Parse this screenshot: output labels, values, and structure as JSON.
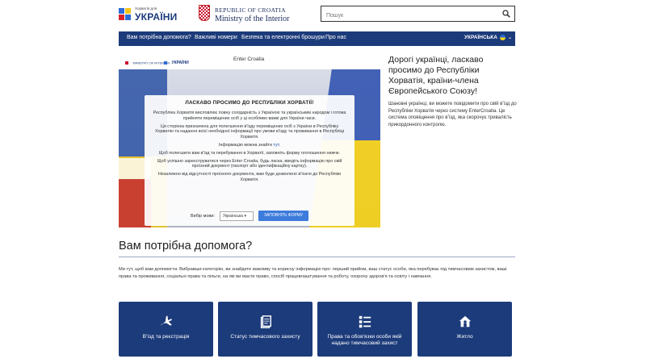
{
  "header": {
    "ua_logo_small": "Хорватія для",
    "ua_logo_big": "УКРАЇНИ",
    "mi_line1": "REPUBLIC OF CROATIA",
    "mi_line2": "Ministry of the Interior",
    "search_placeholder": "Пошук"
  },
  "nav": {
    "items": [
      {
        "label": "Вам потрібна допомога?"
      },
      {
        "label": "Важливі номери"
      },
      {
        "label": "Безпека та електронні брошури"
      },
      {
        "label": "Про нас"
      }
    ],
    "language": "УКРАЇНСЬКА"
  },
  "hero": {
    "mini_logo1": "MINISTRY OF INTERIOR",
    "mini_logo2": "УКРАЇНИ",
    "enter_croatia": "Enter Croatia",
    "card_title": "ЛАСКАВО ПРОСИМО ДО РЕСПУБЛІКИ ХОРВАТІЇ!",
    "p1": "Республіка Хорватія висловлює повну солідарність з Україною та українським народом і готова прийняти переміщених осіб у ці особливо важкі для України часи.",
    "p2": "Ця сторінка призначена для полегшення в'їзду переміщених осіб з України в Республіку Хорватію та надання всієї необхідної інформації про умови в'їзду та проживання в Республіці Хорватія.",
    "p3_prefix": "Інформацію можна знайти ",
    "p3_link": "тут",
    "p3_suffix": ".",
    "p4": "Щоб полегшити вам в'їзд та перебування в Хорватії, заповніть форму оголошення нижче.",
    "p5": "Щоб успішно зареєструватися через Enter Croatia, будь ласка, введіть інформацію про свій проїзний документ (паспорт або ідентифікаційну картку).",
    "p6": "Незалежно від відсутності проїзного документа, вам буде дозволено в'їхати до Республіки Хорватія.",
    "select_label": "Вибір мови:",
    "select_value": "Українська",
    "fill_button": "ЗАПОВНІТЬ ФОРМУ"
  },
  "welcome": {
    "title": "Дорогі українці, ласкаво просимо до Республіки Хорватія, країни-члена Європейського Союзу!",
    "body": "Шановні українці, ви можете повідомити про свій в'їзд до Республіки Хорватія через систему EnterCroatia. Це система оповіщення про в'їзд, яка скорочує тривалість прикордонного контролю."
  },
  "help": {
    "title": "Вам потрібна допомога?",
    "desc": "Ми тут, щоб вам допомогти. Вибравши категорію, ви знайдете важливу та корисну інформацію про: перший прийом, ваш статус особи, яка перебуває під тимчасовим захистом, ваші права та проживання, соціальні права та пільги, на які ви маєте право, спосіб працевлаштування та роботу, охорону здоров'я та освіту і навчання.",
    "cards": [
      {
        "label": "В'їзд та реєстрація",
        "icon": "plane-icon"
      },
      {
        "label": "Статус тимчасового захисту",
        "icon": "document-icon"
      },
      {
        "label": "Права та обов'язки особи якій надано тимчасовий захист",
        "icon": "list-icon"
      },
      {
        "label": "Житло",
        "icon": "housing-icon"
      }
    ]
  },
  "colors": {
    "navy": "#1c3b7a",
    "button_blue": "#3d7bdc"
  }
}
